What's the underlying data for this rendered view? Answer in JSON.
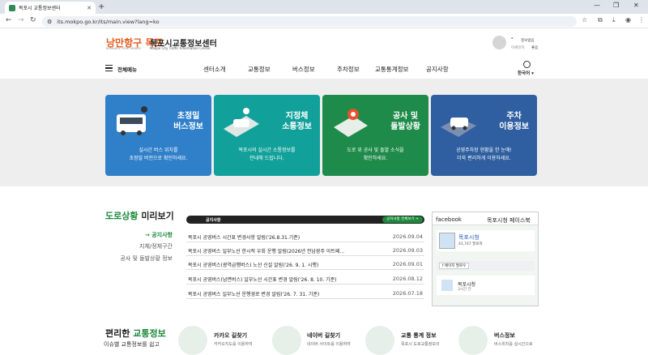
{
  "browser": {
    "tab_title": "목포시 교통정보센터",
    "url": "its.mokpo.go.kr/its/main.view?lang=ko"
  },
  "header": {
    "logo_kr": "낭만항구 목포",
    "logo_small": "ROMANTIC PORT MOKPO",
    "title": "목포시교통정보센터",
    "subtitle": "Mokpo City Traffic Information Center",
    "user_name": "-",
    "user_rows": [
      {
        "label": "",
        "value": "정보없음"
      },
      {
        "label": "미세먼지",
        "value": "좋음"
      }
    ],
    "all_menu": "전체메뉴",
    "nav": [
      "센터소개",
      "교통정보",
      "버스정보",
      "주차정보",
      "교통통계정보",
      "공지사항"
    ],
    "language": "한국어"
  },
  "hero_cards": [
    {
      "title_lines": [
        "초정밀",
        "버스정보"
      ],
      "desc_lines": [
        "실시간 버스 위치를",
        "초정밀 버전으로 확인하세요."
      ],
      "color": "#2f7fc9"
    },
    {
      "title_lines": [
        "지정체",
        "소통정보"
      ],
      "desc_lines": [
        "목포시의 실시간 소통정보를",
        "안내해 드립니다."
      ],
      "color": "#12a19a"
    },
    {
      "title_lines": [
        "공사 및",
        "돌발상황"
      ],
      "desc_lines": [
        "도로 위 공사 및 돌발 소식을",
        "확인하세요."
      ],
      "color": "#1f8b4a"
    },
    {
      "title_lines": [
        "주차",
        "이용정보"
      ],
      "desc_lines": [
        "공영주차장 현황을 한 눈에!",
        "더욱 편리하게 이용하세요."
      ],
      "color": "#2f5fa0"
    }
  ],
  "road_section": {
    "title_green": "도로상황",
    "title_rest": " 미리보기",
    "menu": [
      "공지사항",
      "지체/정체구간",
      "공사 및 돌발상황 정보"
    ],
    "notice_label": "공지사항",
    "notice_all": "공지사항 전체보기 +",
    "notices": [
      {
        "title": "목포시 공영버스 시간표 변경사항 알림('26.8.31.기준)",
        "date": "2026.09.04"
      },
      {
        "title": "목포시 공영버스 일부노선 한시적 우회 운행 알림(2026년 전남광주 아트페...",
        "date": "2026.09.03"
      },
      {
        "title": "목포시 공영버스(광역급행버스) 노선 신설 알림('26. 9. 1. 시행)",
        "date": "2026.09.01"
      },
      {
        "title": "목포시 공영버스(남면버스) 일부노선 시간표 변경 알림('26. 8. 10. 기준)",
        "date": "2026.08.12"
      },
      {
        "title": "목포시 공영버스 일부노선 운행경로 변경 알림('26. 7. 31. 기준)",
        "date": "2026.07.18"
      }
    ]
  },
  "facebook": {
    "tab": "facebook",
    "page_title": "목포시청 페이스북",
    "page_name": "목포시청",
    "followers": "41,747 팔로워",
    "like_button": "페이지 팔로우",
    "post_author": "목포시청",
    "post_time": "3시간 전"
  },
  "bottom": {
    "title_rest": "편리한 ",
    "title_green": "교통정보",
    "subtitle": "이슈별 교통정보를 쉽고",
    "items": [
      {
        "label": "카카오 길찾기",
        "desc": "카카오지도를 이용하여"
      },
      {
        "label": "네이버 길찾기",
        "desc": "네이버 사이트를 이용하여"
      },
      {
        "label": "교통 통계 정보",
        "desc": "목포시 도로교통정보의"
      },
      {
        "label": "버스정보",
        "desc": "버스위치를 실시간으로"
      }
    ]
  }
}
